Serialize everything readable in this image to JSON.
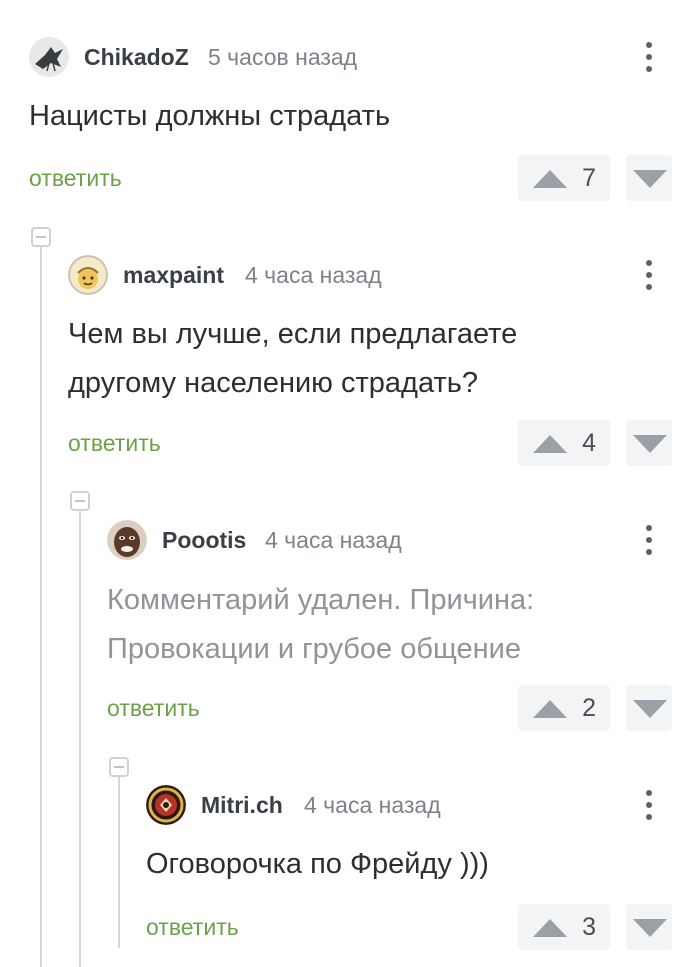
{
  "comments": [
    {
      "author": "ChikadoZ",
      "time": "5 часов назад",
      "text": [
        "Нацисты должны страдать"
      ],
      "reply": "ответить",
      "votes": "7",
      "avatar_icon": "bird-avatar-icon"
    },
    {
      "author": "maxpaint",
      "time": "4 часа назад",
      "text": [
        "Чем вы лучше, если предлагаете",
        "другому населению страдать?"
      ],
      "reply": "ответить",
      "votes": "4",
      "avatar_icon": "cartoon-face-avatar-icon"
    },
    {
      "author": "Poootis",
      "time": "4 часа назад",
      "text": [
        "Комментарий удален. Причина:",
        "Провокации и грубое общение"
      ],
      "deleted": true,
      "reply": "ответить",
      "votes": "2",
      "avatar_icon": "face-photo-avatar-icon"
    },
    {
      "author": "Mitri.ch",
      "time": "4 часа назад",
      "text": [
        "Оговорочка по Фрейду )))"
      ],
      "reply": "ответить",
      "votes": "3",
      "avatar_icon": "badge-logo-avatar-icon"
    }
  ],
  "colors": {
    "reply": "#6ea04a",
    "text": "#2b2f33",
    "deleted_text": "#8f9499",
    "time": "#7c8288",
    "vote_bg": "#f3f4f5",
    "arrow": "#9aa0a6"
  }
}
